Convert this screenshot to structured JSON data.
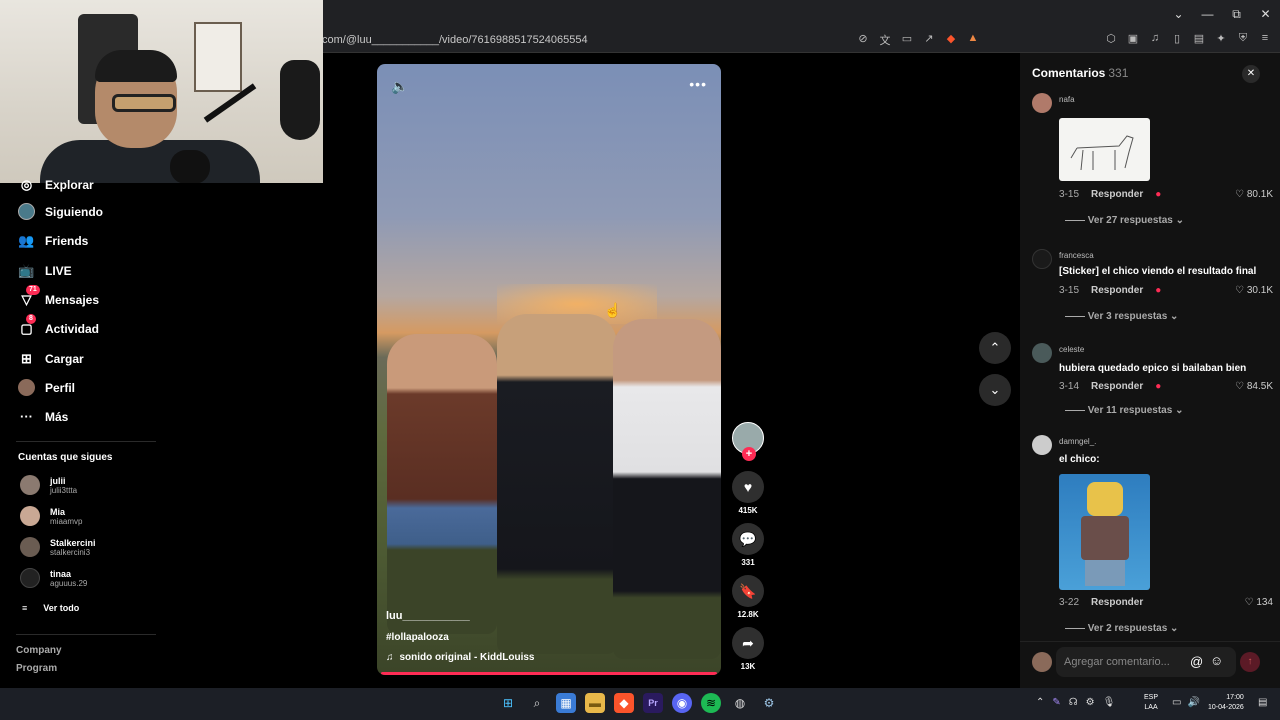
{
  "browser": {
    "url": "com/@luu___________/video/7616988517524065554",
    "window_controls": [
      "⌄",
      "—",
      "⧉",
      "✕"
    ]
  },
  "sidebar": {
    "items": [
      {
        "label": "Explorar",
        "icon": "compass-icon"
      },
      {
        "label": "Siguiendo",
        "icon": "following-avatar-icon"
      },
      {
        "label": "Friends",
        "icon": "friends-icon"
      },
      {
        "label": "LIVE",
        "icon": "live-icon"
      },
      {
        "label": "Mensajes",
        "icon": "messages-icon",
        "badge": "71"
      },
      {
        "label": "Actividad",
        "icon": "activity-icon",
        "badge": "8"
      },
      {
        "label": "Cargar",
        "icon": "upload-icon"
      },
      {
        "label": "Perfil",
        "icon": "profile-icon"
      },
      {
        "label": "Más",
        "icon": "more-icon"
      }
    ],
    "following_title": "Cuentas que sigues",
    "accounts": [
      {
        "name": "julii",
        "handle": "julii3ttta"
      },
      {
        "name": "Mia",
        "handle": "miaamvp"
      },
      {
        "name": "Stalkercini",
        "handle": "stalkercini3"
      },
      {
        "name": "tinaa",
        "handle": "aguuus.29"
      }
    ],
    "see_all": "Ver todo",
    "footer": [
      "Company",
      "Program"
    ]
  },
  "video": {
    "username": "luu___________",
    "hashtag": "#lollapalooza",
    "sound": "sonido original - KiddLouiss",
    "likes": "415K",
    "comments": "331",
    "saves": "12.8K",
    "shares": "13K",
    "progress": 1.0
  },
  "comments": {
    "title": "Comentarios",
    "count": "331",
    "items": [
      {
        "user": "nafa",
        "text": "",
        "date": "3-15",
        "reply": "Responder",
        "likes": "80.1K",
        "replies": "Ver 27 respuestas",
        "image": "horse-sketch"
      },
      {
        "user": "francesca",
        "text": "[Sticker] el chico viendo el resultado final",
        "date": "3-15",
        "reply": "Responder",
        "likes": "30.1K",
        "replies": "Ver 3 respuestas"
      },
      {
        "user": "celeste",
        "text": "hubiera quedado epico si bailaban bien",
        "date": "3-14",
        "reply": "Responder",
        "likes": "84.5K",
        "replies": "Ver 11 respuestas"
      },
      {
        "user": "damngel_.",
        "text": "el chico:",
        "date": "3-22",
        "reply": "Responder",
        "likes": "134",
        "replies": "Ver 2 respuestas",
        "image": "roblox-character"
      }
    ],
    "input_placeholder": "Agregar comentario..."
  },
  "taskbar": {
    "lang_top": "ESP",
    "lang_bottom": "LAA",
    "time": "17:00",
    "date": "10-04-2026"
  },
  "colors": {
    "accent": "#fe2c55",
    "background": "#000000",
    "panel": "#121212"
  }
}
